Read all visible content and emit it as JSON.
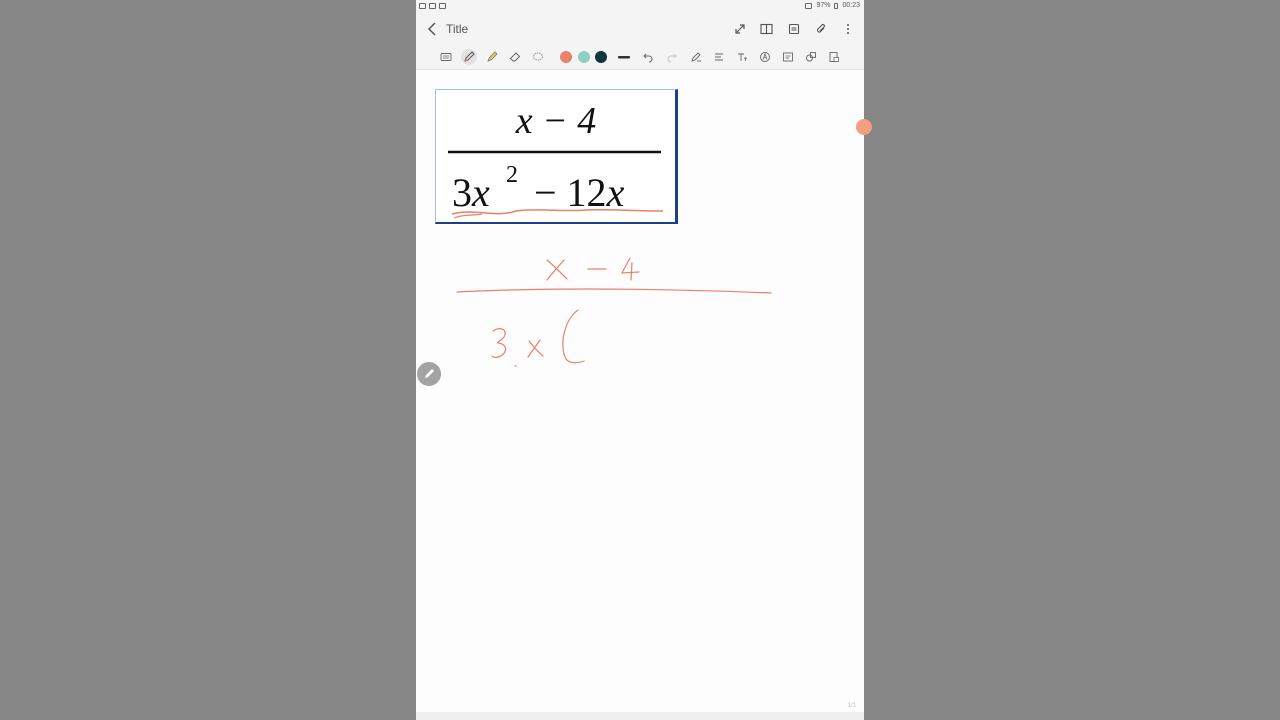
{
  "status": {
    "battery": "97%",
    "time": "00:23"
  },
  "header": {
    "title": "Title"
  },
  "toolbar": {
    "colors": {
      "salmon": "#e8806a",
      "teal": "#8fd0c0",
      "dark": "#10363e"
    },
    "icons": [
      "keyboard-icon",
      "pen-icon",
      "highlighter-icon",
      "eraser-icon",
      "lasso-icon",
      "undo-icon",
      "redo-icon",
      "handwriting-to-text-icon",
      "straighten-icon",
      "text-icon",
      "format-icon",
      "insert-icon",
      "shapes-icon",
      "page-lock-icon"
    ]
  },
  "image": {
    "numerator": "x − 4",
    "denominator_a": "3x",
    "exponent": "2",
    "denominator_b": "− 12x"
  },
  "page_indicator": "1/1"
}
